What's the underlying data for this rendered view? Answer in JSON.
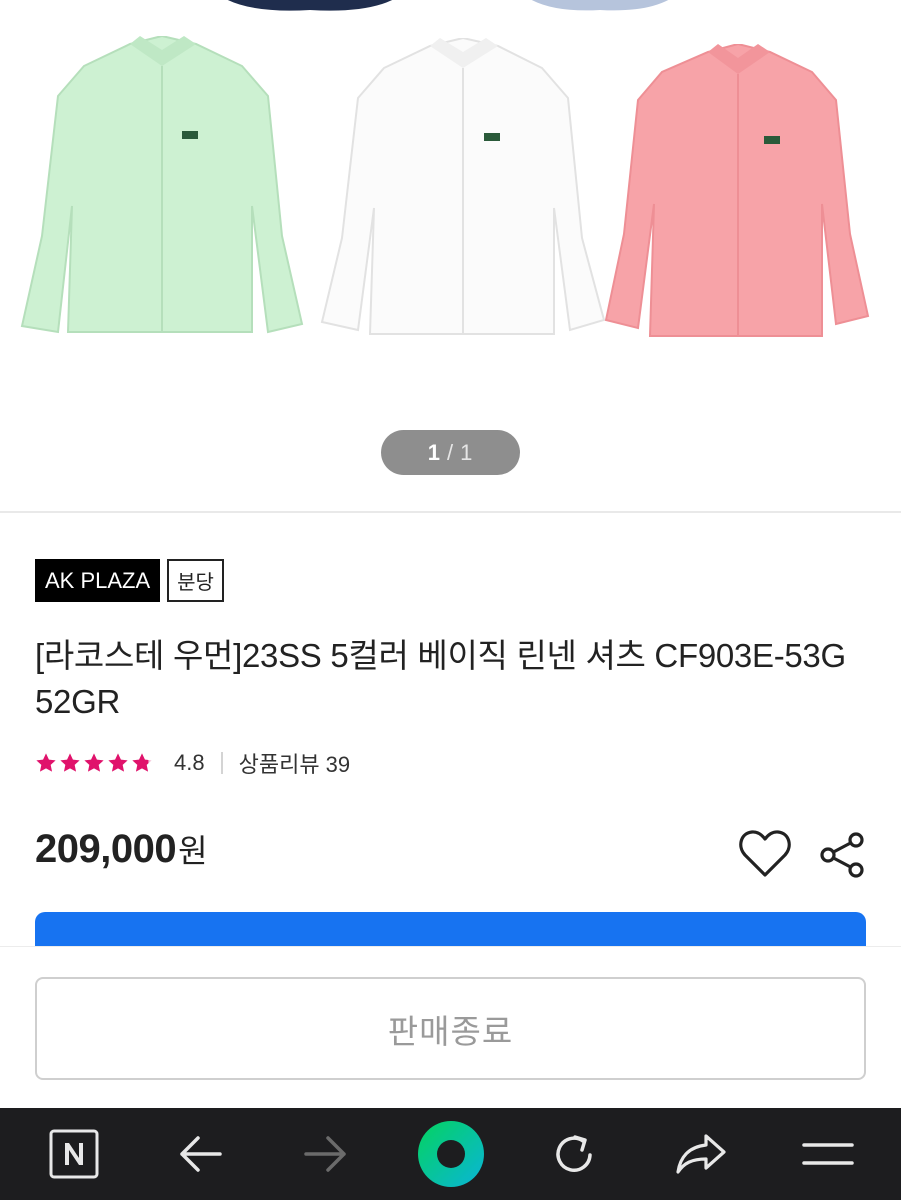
{
  "gallery": {
    "current": "1",
    "separator": "/",
    "total": "1",
    "shirt_colors": [
      "#c9f0cf",
      "#fbfbfb",
      "#f6a0a6"
    ]
  },
  "product": {
    "brand_badge": "AK PLAZA",
    "branch_badge": "분당",
    "title": "[라코스테 우먼]23SS 5컬러 베이직 린넨 셔츠 CF903E-53G 52GR",
    "rating": 4.8,
    "rating_display": "4.8",
    "review_label": "상품리뷰 39",
    "price": "209,000",
    "price_unit": "원",
    "star_color": "#e0126b"
  },
  "actions": {
    "wishlist_icon": "heart-outline-icon",
    "share_icon": "share-icon",
    "buy_button_color": "#1773f1",
    "soldout_label": "판매종료"
  },
  "browser_toolbar": {
    "items": [
      "naver-n-icon",
      "back-arrow-icon",
      "forward-arrow-icon",
      "green-dot-icon",
      "reload-icon",
      "share-arrow-icon",
      "menu-icon"
    ],
    "accent": "#03c75a"
  }
}
